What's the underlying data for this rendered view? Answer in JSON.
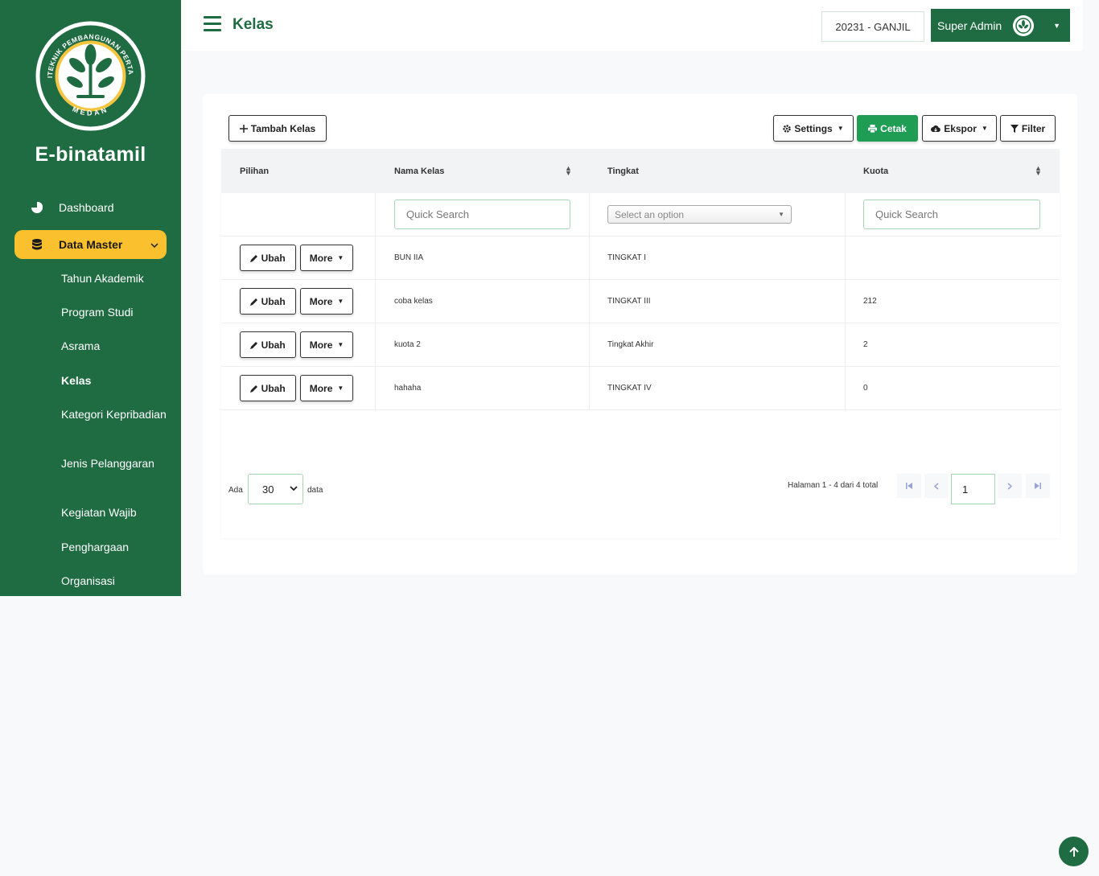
{
  "sidebar": {
    "brand": "E-binatamil",
    "logo": {
      "top_text": "POLITEKNIK PEMBANGUNAN PERTANIAN",
      "bottom_text": "MEDAN"
    },
    "dashboard_label": "Dashboard",
    "data_master_label": "Data Master",
    "sub_items": [
      "Tahun Akademik",
      "Program Studi",
      "Asrama",
      "Kelas",
      "Kategori Kepribadian",
      "Jenis Pelanggaran",
      "Kegiatan Wajib",
      "Penghargaan",
      "Organisasi"
    ]
  },
  "header": {
    "title": "Kelas",
    "period": "20231 - GANJIL",
    "user": "Super Admin"
  },
  "toolbar": {
    "add_label": "Tambah Kelas",
    "settings_label": "Settings",
    "print_label": "Cetak",
    "export_label": "Ekspor",
    "filter_label": "Filter"
  },
  "table": {
    "headers": [
      "Pilihan",
      "Nama Kelas",
      "Tingkat",
      "Kuota"
    ],
    "filters": {
      "nama_placeholder": "Quick Search",
      "tingkat_placeholder": "Select an option",
      "kuota_placeholder": "Quick Search"
    },
    "edit_label": "Ubah",
    "more_label": "More",
    "rows": [
      {
        "nama": "BUN IIA",
        "tingkat": "TINGKAT I",
        "kuota": ""
      },
      {
        "nama": "coba kelas",
        "tingkat": "TINGKAT III",
        "kuota": "212"
      },
      {
        "nama": "kuota 2",
        "tingkat": "Tingkat Akhir",
        "kuota": "2"
      },
      {
        "nama": "hahaha",
        "tingkat": "TINGKAT IV",
        "kuota": "0"
      }
    ]
  },
  "pagination": {
    "ada_label": "Ada",
    "per_page": "30",
    "data_label": "data",
    "info": "Halaman 1 - 4 dari 4 total",
    "current_page": "1"
  },
  "colors": {
    "primary": "#1f6b42",
    "accent": "#fbc02d",
    "print": "#1f9d55"
  }
}
